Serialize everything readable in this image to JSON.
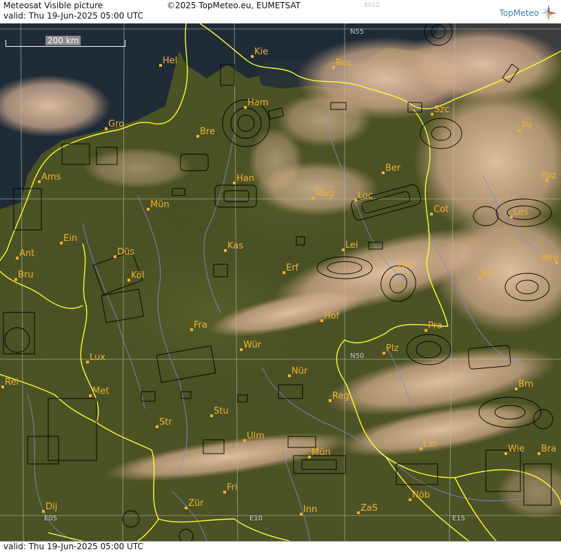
{
  "header": {
    "product_title": "Meteosat Visible picture",
    "copyright": "©2025 TopMeteo.eu, EUMETSAT",
    "code": "8011",
    "valid": "valid:  Thu  19-Jun-2025  05:00 UTC",
    "brand": "TopMeteo",
    "logo_icon": "compass-star-icon"
  },
  "footer": {
    "valid": "valid:  Thu  19-Jun-2025  05:00 UTC"
  },
  "scale_bar": {
    "label": "200 km"
  },
  "grid_labels": [
    "N55",
    "N50",
    "E05",
    "E10",
    "E15"
  ],
  "cities": [
    {
      "code": "Kie",
      "name": "Kiel"
    },
    {
      "code": "Hel",
      "name": "Helgoland"
    },
    {
      "code": "Ros",
      "name": "Rostock"
    },
    {
      "code": "Ham",
      "name": "Hamburg"
    },
    {
      "code": "Szc",
      "name": "Szczecin"
    },
    {
      "code": "Gro",
      "name": "Groningen"
    },
    {
      "code": "Bre",
      "name": "Bremen"
    },
    {
      "code": "Pil",
      "name": "Pila"
    },
    {
      "code": "Ber",
      "name": "Berlin"
    },
    {
      "code": "Ams",
      "name": "Amsterdam"
    },
    {
      "code": "Han",
      "name": "Hannover"
    },
    {
      "code": "Poz",
      "name": "Poznan"
    },
    {
      "code": "Mag",
      "name": "Magdeburg"
    },
    {
      "code": "Loc",
      "name": "Lausitz"
    },
    {
      "code": "Mün",
      "name": "Münster"
    },
    {
      "code": "Cot",
      "name": "Cottbus"
    },
    {
      "code": "Les",
      "name": "Leszno"
    },
    {
      "code": "Ein",
      "name": "Eindhoven"
    },
    {
      "code": "Lei",
      "name": "Leipzig"
    },
    {
      "code": "Kas",
      "name": "Kassel"
    },
    {
      "code": "Ant",
      "name": "Antwerpen"
    },
    {
      "code": "Düs",
      "name": "Düsseldorf"
    },
    {
      "code": "Wro",
      "name": "Wroclaw"
    },
    {
      "code": "Dre",
      "name": "Dresden"
    },
    {
      "code": "Erf",
      "name": "Erfurt"
    },
    {
      "code": "Bru",
      "name": "Bruxelles"
    },
    {
      "code": "Köl",
      "name": "Köln"
    },
    {
      "code": "Jel",
      "name": "Jelenia Góra"
    },
    {
      "code": "Hof",
      "name": "Hof"
    },
    {
      "code": "Fra",
      "name": "Frankfurt"
    },
    {
      "code": "Pra",
      "name": "Praha"
    },
    {
      "code": "Wür",
      "name": "Würzburg"
    },
    {
      "code": "Plz",
      "name": "Plzen"
    },
    {
      "code": "Lux",
      "name": "Luxembourg"
    },
    {
      "code": "Nür",
      "name": "Nürnberg"
    },
    {
      "code": "Rei",
      "name": "Reims"
    },
    {
      "code": "Met",
      "name": "Metz"
    },
    {
      "code": "Reg",
      "name": "Regensburg"
    },
    {
      "code": "Brn",
      "name": "Brno"
    },
    {
      "code": "Stu",
      "name": "Stuttgart"
    },
    {
      "code": "Str",
      "name": "Strasbourg"
    },
    {
      "code": "Ulm",
      "name": "Ulm"
    },
    {
      "code": "Lin",
      "name": "Linz"
    },
    {
      "code": "Mün",
      "name": "München"
    },
    {
      "code": "Wie",
      "name": "Wien"
    },
    {
      "code": "Bra",
      "name": "Bratislava"
    },
    {
      "code": "Fri",
      "name": "Friedrichshafen"
    },
    {
      "code": "Nöb",
      "name": "Nöb"
    },
    {
      "code": "Dij",
      "name": "Dijon"
    },
    {
      "code": "Zür",
      "name": "Zürich"
    },
    {
      "code": "Inn",
      "name": "Innsbruck"
    },
    {
      "code": "ZaS",
      "name": "Zell am See"
    }
  ],
  "colors": {
    "land": "#4b5224",
    "sea": "#1f2c38",
    "cloud": "#d9b597",
    "border": "#ffff33",
    "city_label": "#f2b233",
    "river": "#7c8cd6",
    "airspace": "#000000",
    "grid": "#bdbdbd"
  }
}
